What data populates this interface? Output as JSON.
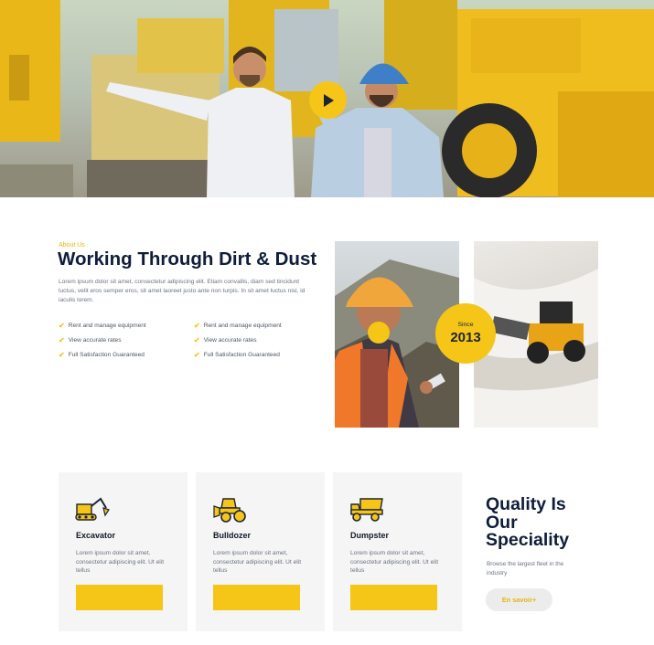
{
  "hero": {
    "play_icon": "play-icon"
  },
  "about": {
    "eyebrow": "About Us",
    "title": "Working Through Dirt & Dust",
    "description": "Lorem ipsum dolor sit amet, consectetur adipiscing elit. Etiam convallis, diam sed tincidunt luctus, velit eros semper eros, sit amet laoreet justo ante non turpis. In sit amet luctus nisl, id iaculis lorem.",
    "features_left": [
      "Rent and manage equipment",
      "View accurate rates",
      "Full Satisfaction Guaranteed"
    ],
    "features_right": [
      "Rent and manage equipment",
      "View accurate rates",
      "Full Satisfaction Guaranteed"
    ],
    "badge": {
      "label": "Since",
      "year": "2013"
    }
  },
  "services": [
    {
      "icon": "excavator-icon",
      "title": "Excavator",
      "text": "Lorem ipsum dolor sit amet, consectetur adipiscing elit. Ut elit tellus"
    },
    {
      "icon": "bulldozer-icon",
      "title": "Bulldozer",
      "text": "Lorem ipsum dolor sit amet, consectetur adipiscing elit. Ut elit tellus"
    },
    {
      "icon": "dump-truck-icon",
      "title": "Dumpster",
      "text": "Lorem ipsum dolor sit amet, consectetur adipiscing elit. Ut elit tellus"
    }
  ],
  "quality": {
    "line1": "Quality Is",
    "line2": "Our",
    "line3": "Speciality",
    "subtitle": "Browse the largest fleet in the industry",
    "button": "En savoir+"
  },
  "colors": {
    "accent": "#f5c518",
    "heading": "#0f1d3b",
    "card_bg": "#f5f5f5"
  }
}
